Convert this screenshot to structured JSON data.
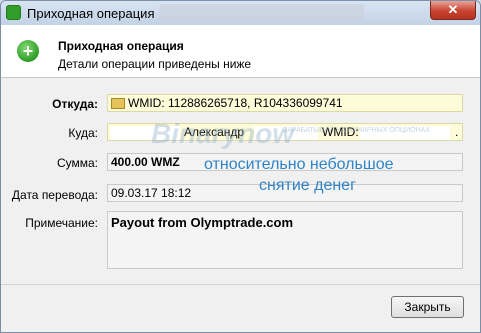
{
  "window": {
    "title": "Приходная операция",
    "close_glyph": "✕"
  },
  "header": {
    "title": "Приходная операция",
    "subtitle": "Детали операции приведены ниже",
    "icon": "plus-circle-icon"
  },
  "fields": {
    "from": {
      "label": "Откуда:",
      "value": "WMID: 112886265718, R104336099741",
      "icon": "wallet-icon"
    },
    "to": {
      "label": "Куда:",
      "name": "Александр",
      "wmid_label": "WMID:",
      "trailing": "."
    },
    "amount": {
      "label": "Сумма:",
      "value": "400.00 WMZ"
    },
    "date": {
      "label": "Дата перевода:",
      "value": "09.03.17 18:12"
    },
    "note": {
      "label": "Примечание:",
      "value": "Payout from Olymptrade.com"
    }
  },
  "buttons": {
    "close": "Закрыть"
  },
  "watermark": {
    "logo": "Binarynow",
    "tagline": "ЗАРАБАТЫВАЙ НА БИНАРНЫХ ОПЦИОНАХ"
  },
  "overlay": {
    "line1": "относительно небольшое",
    "line2": "снятие денег"
  },
  "colors": {
    "titlebar": "#c3d2e6",
    "close_red": "#c8432f",
    "highlight_field": "#fdfbd8",
    "overlay_text": "#2f84c8"
  }
}
